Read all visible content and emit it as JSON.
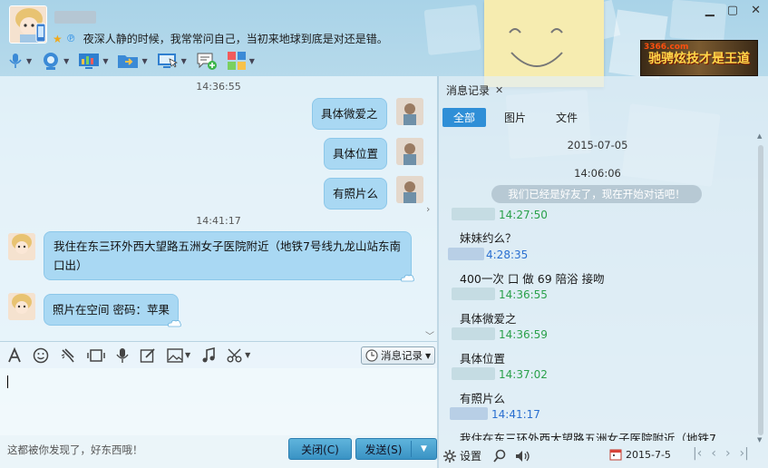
{
  "header": {
    "signature": "夜深人静的时候，我常常问自己，当初来地球到底是对还是错。",
    "window_controls": [
      "minimize-icon",
      "maximize-icon",
      "close-icon"
    ],
    "toolbar_icons": [
      "microphone-icon",
      "video-camera-icon",
      "screen-share-icon",
      "folder-transfer-icon",
      "remote-desktop-icon",
      "sms-icon",
      "apps-grid-icon"
    ],
    "ad": {
      "logo": "3366.com",
      "text": "驰骋炫技才是王道"
    }
  },
  "chat": {
    "messages": [
      {
        "type": "timestamp",
        "text": "14:36:55"
      },
      {
        "type": "me",
        "text": "具体微爱之"
      },
      {
        "type": "me",
        "text": "具体位置"
      },
      {
        "type": "me",
        "text": "有照片么"
      },
      {
        "type": "timestamp",
        "text": "14:41:17"
      },
      {
        "type": "friend",
        "text": "我住在东三环外西大望路五洲女子医院附近（地铁7号线九龙山站东南口出）"
      },
      {
        "type": "friend",
        "text": "照片在空间 密码：苹果"
      }
    ]
  },
  "input_toolbar": {
    "icons": [
      "font-icon",
      "emoji-icon",
      "shake-icon",
      "screenshot-icon",
      "voice-msg-icon",
      "doodle-icon",
      "image-icon",
      "music-icon",
      "scissors-icon"
    ],
    "history_button": "消息记录"
  },
  "bottom": {
    "tip": "这都被你发现了，好东西哦！",
    "close_label": "关闭(C)",
    "send_label": "发送(S)"
  },
  "history": {
    "title": "消息记录",
    "tabs": [
      "全部",
      "图片",
      "文件"
    ],
    "date": "2015-07-05",
    "first_time": "14:06:06",
    "system_msg": "我们已经是好友了，现在开始对话吧！",
    "entries": [
      {
        "time": "14:27:50",
        "color": "green",
        "text": "妹妹约么？"
      },
      {
        "time": "4:28:35",
        "color": "blue",
        "text": "400一次 口 做 69 陪浴 接吻"
      },
      {
        "time": "14:36:55",
        "color": "green",
        "text": "具体微爱之"
      },
      {
        "time": "14:36:59",
        "color": "green",
        "text": "具体位置"
      },
      {
        "time": "14:37:02",
        "color": "green",
        "text": "有照片么"
      },
      {
        "time": "14:41:17",
        "color": "blue",
        "text": "我住在东三环外西大望路五洲女子医院附近（地铁7"
      }
    ],
    "footer": {
      "settings": "设置",
      "date": "2015-7-5"
    }
  }
}
